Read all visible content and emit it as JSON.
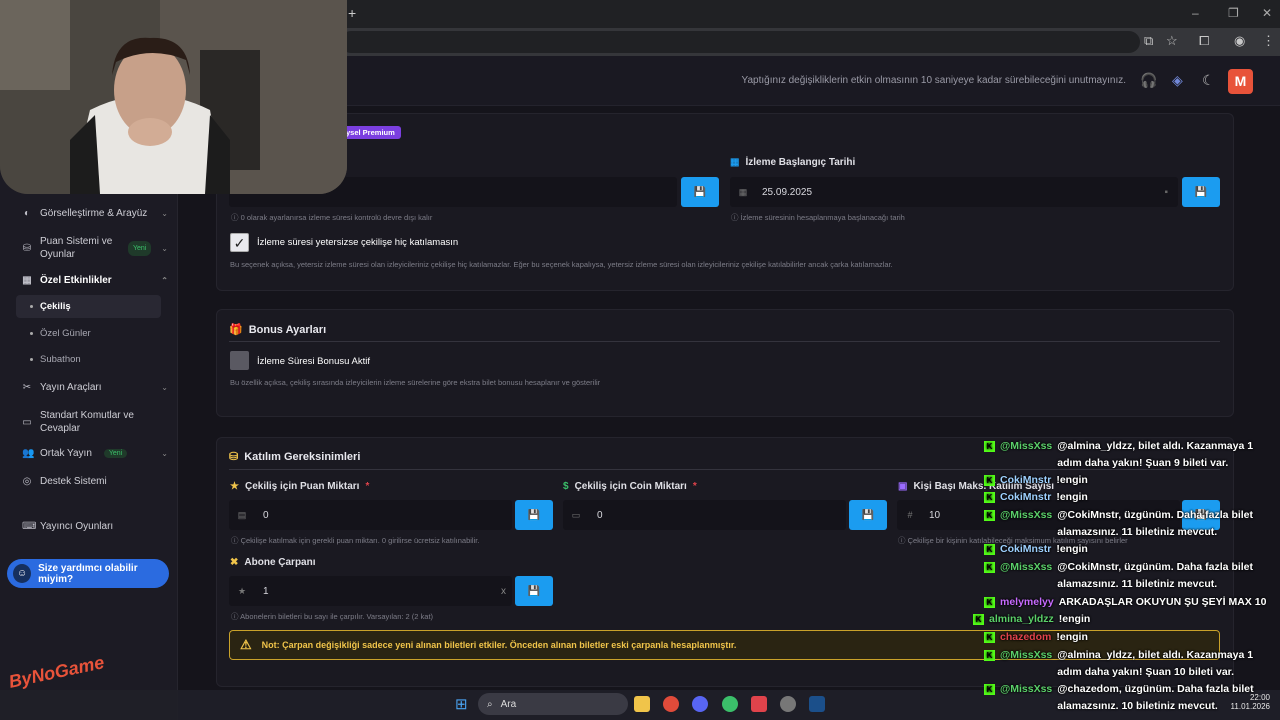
{
  "browser": {
    "new_tab": "+",
    "win_controls": [
      "–",
      "❐",
      "✕"
    ]
  },
  "header": {
    "note": "Yaptığınız değişikliklerin etkin olmasının 10 saniyeye kadar sürebileceğini unutmayınız.",
    "avatar_letter": "M"
  },
  "sidebar": {
    "items": [
      {
        "label": "Görselleştirme & Arayüz",
        "icon": "palette-icon"
      },
      {
        "label": "Puan Sistemi ve Oyunlar",
        "badge": "Yeni",
        "icon": "coins-icon"
      },
      {
        "label": "Özel Etkinlikler",
        "icon": "calendar-icon"
      },
      {
        "label": "Yayın Araçları",
        "icon": "tools-icon"
      },
      {
        "label": "Standart Komutlar ve Cevaplar",
        "icon": "terminal-icon"
      },
      {
        "label": "Ortak Yayın",
        "badge": "Yeni",
        "icon": "users-icon"
      },
      {
        "label": "Destek Sistemi",
        "icon": "support-icon"
      },
      {
        "label": "Yayıncı Oyunları",
        "icon": "gamepad-icon"
      }
    ],
    "sub_items": [
      "Çekiliş",
      "Özel Günler",
      "Subathon"
    ],
    "help_button": "Size yardımcı olabilir miyim?",
    "watermark": "ByNoGame"
  },
  "watch_card": {
    "premium_badge": "ysel Premium",
    "start_date_label": "İzleme Başlangıç Tarihi",
    "start_date_value": "25.09.2025",
    "duration_hint": "0 olarak ayarlanırsa izleme süresi kontrolü devre dışı kalır",
    "date_hint": "İzleme süresinin hesaplanmaya başlanacağı tarih",
    "checkbox_label": "İzleme süresi yetersizse çekilişe hiç katılamasın",
    "checkbox_desc": "Bu seçenek açıksa, yetersiz izleme süresi olan izleyicileriniz çekilişe hiç katılamazlar. Eğer bu seçenek kapalıysa, yetersiz izleme süresi olan izleyicileriniz çekilişe katılabilirler ancak çarka katılamazlar."
  },
  "bonus_card": {
    "title": "Bonus Ayarları",
    "checkbox_label": "İzleme Süresi Bonusu Aktif",
    "desc": "Bu özellik açıksa, çekiliş sırasında izleyicilerin izleme sürelerine göre ekstra bilet bonusu hesaplanır ve gösterilir"
  },
  "join_card": {
    "title": "Katılım Gereksinimleri",
    "points_label": "Çekiliş için Puan Miktarı",
    "points_value": "0",
    "points_hint": "Çekilişe katılmak için gerekli puan miktarı. 0 girilirse ücretsiz katılınabilir.",
    "coin_label": "Çekiliş için Coin Miktarı",
    "coin_value": "0",
    "max_label": "Kişi Başı Maks. Katılım Sayısı",
    "max_value": "10",
    "max_hint": "Çekilişe bir kişinin katılabileceği maksimum katılım sayısını belirler",
    "multiplier_label": "Abone Çarpanı",
    "multiplier_value": "1",
    "multiplier_suffix": "x",
    "multiplier_hint": "Abonelerin biletleri bu sayı ile çarpılır. Varsayılan: 2 (2 kat)",
    "note": "Not: Çarpan değişikliği sadece yeni alınan biletleri etkiler. Önceden alınan biletler eski çarpanla hesaplanmıştır."
  },
  "chat": [
    {
      "user": "@MissXss",
      "color": "#5bd06a",
      "msg": "@almina_yldzz, bilet aldı. Kazanmaya 1 adım daha yakın! Şuan 9 bileti var."
    },
    {
      "user": "CokiMnstr",
      "color": "#9ed1ff",
      "msg": "!engin"
    },
    {
      "user": "CokiMnstr",
      "color": "#9ed1ff",
      "msg": "!engin"
    },
    {
      "user": "@MissXss",
      "color": "#5bd06a",
      "msg": "@CokiMnstr, üzgünüm. Daha fazla bilet alamazsınız. 11 biletiniz mevcut."
    },
    {
      "user": "CokiMnstr",
      "color": "#9ed1ff",
      "msg": "!engin"
    },
    {
      "user": "@MissXss",
      "color": "#5bd06a",
      "msg": "@CokiMnstr, üzgünüm. Daha fazla bilet alamazsınız. 11 biletiniz mevcut."
    },
    {
      "user": "melymelyy",
      "color": "#c76bff",
      "msg": "ARKADAŞLAR OKUYUN ŞU ŞEYİ MAX 10"
    },
    {
      "user": "almina_yldzz",
      "color": "#5bd06a",
      "msg": "!engin"
    },
    {
      "user": "chazedom",
      "color": "#e0434b",
      "msg": "!engin"
    },
    {
      "user": "@MissXss",
      "color": "#5bd06a",
      "msg": "@almina_yldzz, bilet aldı. Kazanmaya 1 adım daha yakın! Şuan 10 bileti var."
    },
    {
      "user": "@MissXss",
      "color": "#5bd06a",
      "msg": "@chazedom, üzgünüm. Daha fazla bilet alamazsınız. 10 biletiniz mevcut."
    }
  ],
  "taskbar": {
    "search": "Ara",
    "time": "22:00",
    "date": "11.01.2026"
  }
}
